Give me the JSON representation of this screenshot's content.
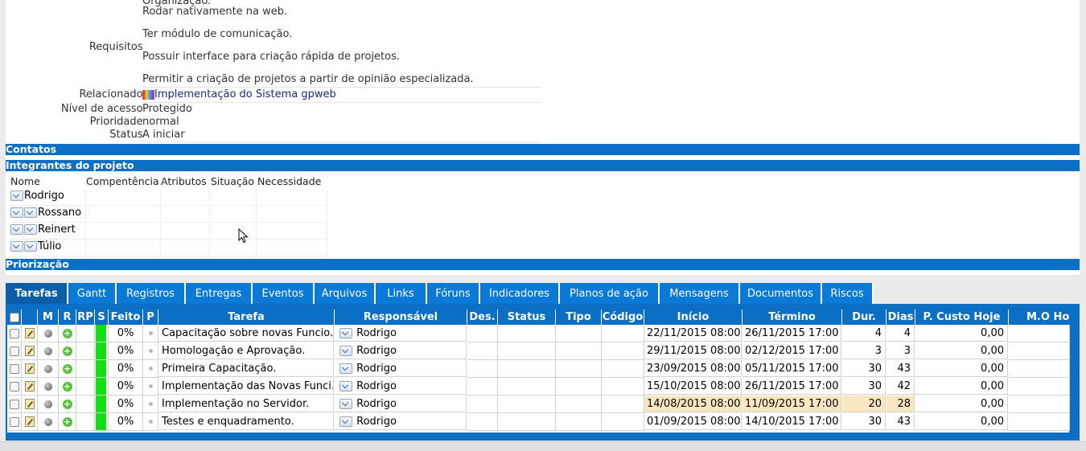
{
  "details": {
    "org_fragment": "Organização.",
    "requisitos_label": "Requisitos:",
    "requisitos_lines": [
      "Rodar nativamente na web.",
      "Ter módulo de comunicação.",
      "Possuir interface para criação rápida de projetos.",
      "Permitir a criação de projetos a partir de opinião especializada."
    ],
    "relacionado_label": "Relacionado:",
    "relacionado_value": "Implementação do Sistema gpweb",
    "nivel_label": "Nível de acesso:",
    "nivel_value": "Protegido",
    "prioridade_label": "Prioridade:",
    "prioridade_value": "normal",
    "status_label": "Status:",
    "status_value": "A iniciar"
  },
  "sections": {
    "contatos": "Contatos",
    "integrantes": "Integrantes do projeto",
    "priorizacao": "Priorização"
  },
  "members": {
    "headers": [
      "Nome",
      "Compentência",
      "Atributos",
      "Situação",
      "Necessidade"
    ],
    "rows": [
      "Rodrigo",
      "Rossano",
      "Reinert",
      "Túlio"
    ]
  },
  "tabs": [
    "Tarefas",
    "Gantt",
    "Registros",
    "Entregas",
    "Eventos",
    "Arquivos",
    "Links",
    "Fóruns",
    "Indicadores",
    "Planos de ação",
    "Mensagens",
    "Documentos",
    "Riscos"
  ],
  "active_tab": "Tarefas",
  "grid": {
    "headers": [
      "M",
      "R",
      "RP",
      "S",
      "Feito",
      "P",
      "Tarefa",
      "Responsável",
      "Des.",
      "Status",
      "Tipo",
      "Código",
      "Início",
      "Término",
      "Dur.",
      "Dias",
      "P. Custo Hoje",
      "M.O Hoj"
    ],
    "rows": [
      {
        "feito": "0%",
        "tarefa": "Capacitação sobre novas Funcio…",
        "resp": "Rodrigo",
        "inicio": "22/11/2015 08:00",
        "termino": "26/11/2015 17:00",
        "dur": "4",
        "dias": "4",
        "custo": "0,00",
        "highlight": false
      },
      {
        "feito": "0%",
        "tarefa": "Homologação e Aprovação.",
        "resp": "Rodrigo",
        "inicio": "29/11/2015 08:00",
        "termino": "02/12/2015 17:00",
        "dur": "3",
        "dias": "3",
        "custo": "0,00",
        "highlight": false
      },
      {
        "feito": "0%",
        "tarefa": "Primeira Capacitação.",
        "resp": "Rodrigo",
        "inicio": "23/09/2015 08:00",
        "termino": "05/11/2015 17:00",
        "dur": "30",
        "dias": "43",
        "custo": "0,00",
        "highlight": false
      },
      {
        "feito": "0%",
        "tarefa": "Implementação das Novas Funci…",
        "resp": "Rodrigo",
        "inicio": "15/10/2015 08:00",
        "termino": "26/11/2015 17:00",
        "dur": "30",
        "dias": "42",
        "custo": "0,00",
        "highlight": false
      },
      {
        "feito": "0%",
        "tarefa": "Implementação no Servidor.",
        "resp": "Rodrigo",
        "inicio": "14/08/2015 08:00",
        "termino": "11/09/2015 17:00",
        "dur": "20",
        "dias": "28",
        "custo": "0,00",
        "highlight": true
      },
      {
        "feito": "0%",
        "tarefa": "Testes e enquadramento.",
        "resp": "Rodrigo",
        "inicio": "01/09/2015 08:00",
        "termino": "14/10/2015 17:00",
        "dur": "30",
        "dias": "43",
        "custo": "0,00",
        "highlight": false
      }
    ]
  },
  "colors": {
    "header_blue": "#0b6fc4",
    "tab_blue": "#0b79d6",
    "status_green": "#11e011",
    "highlight": "#fbe6c2"
  }
}
